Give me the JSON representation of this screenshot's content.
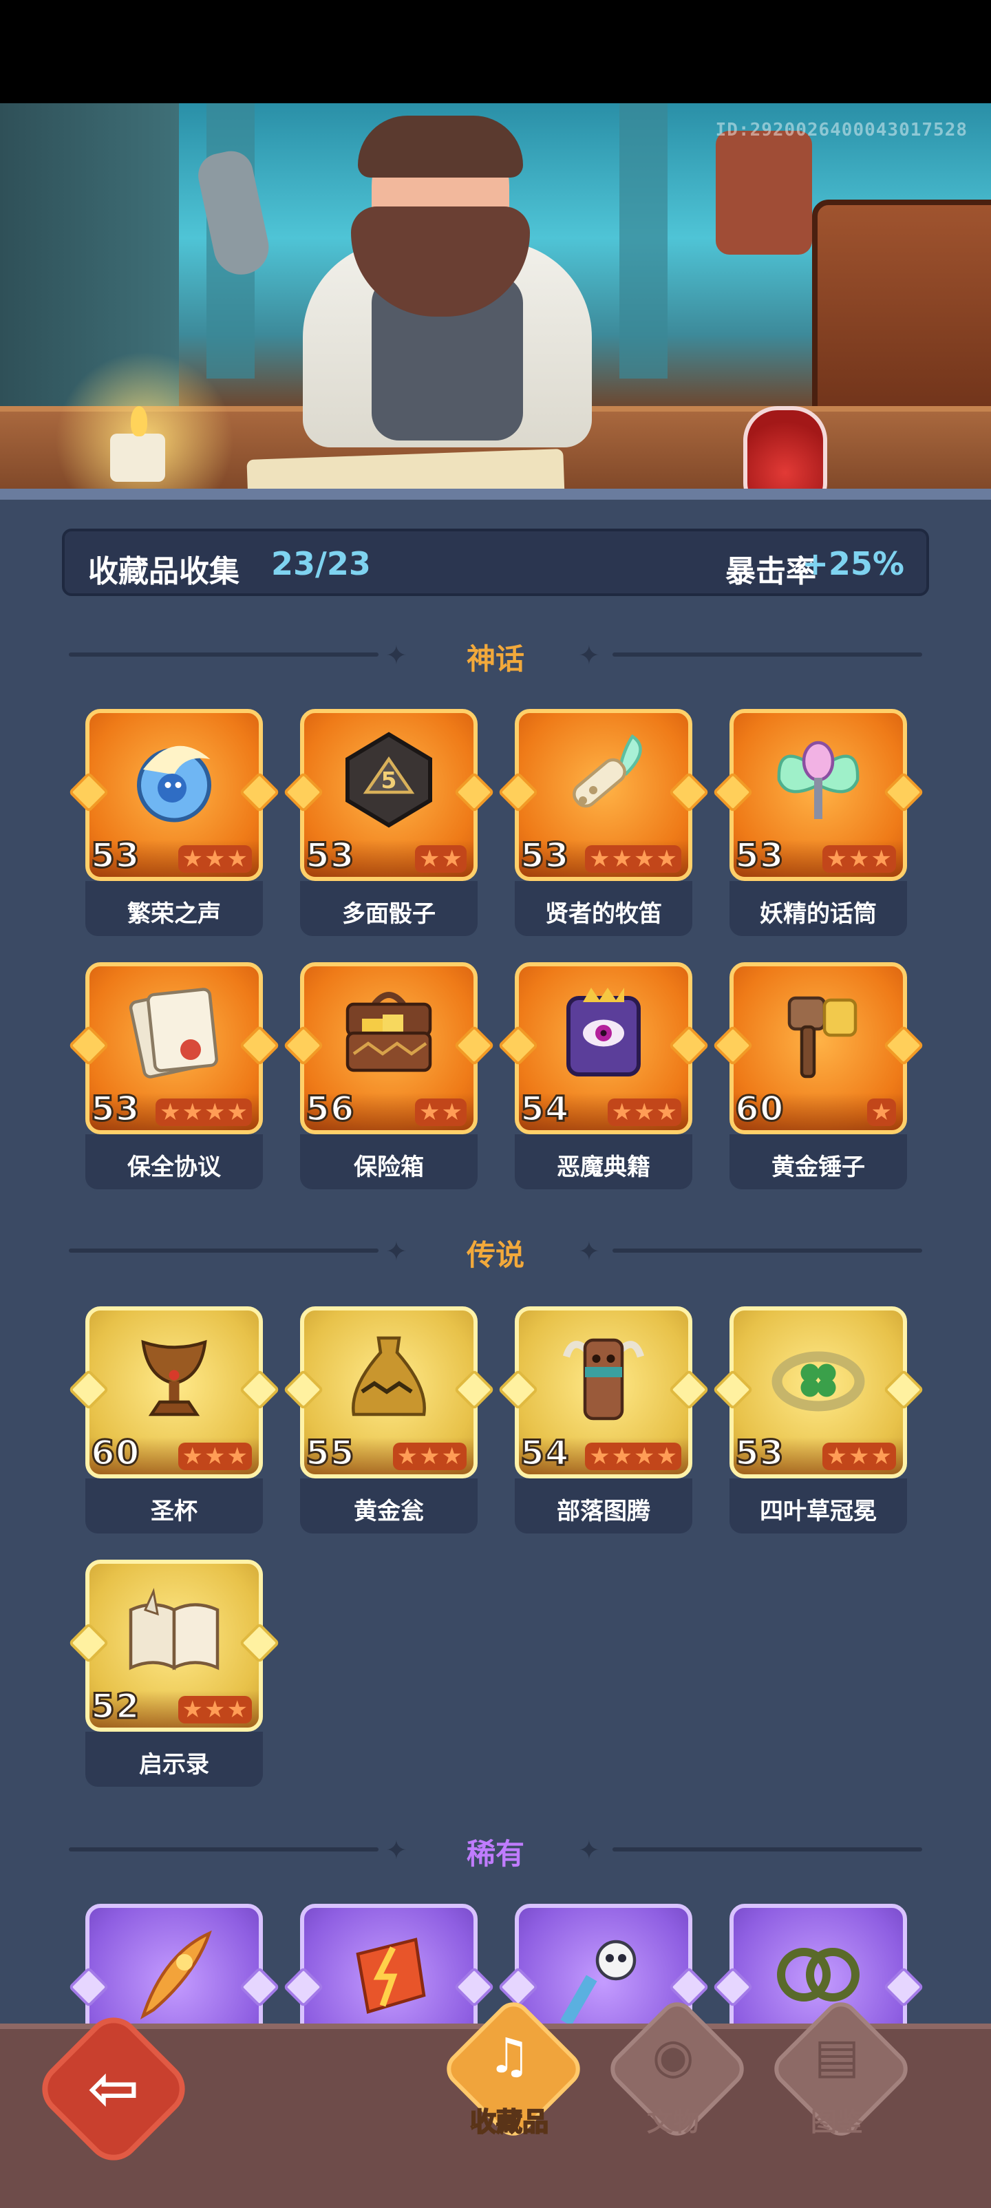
{
  "banner": {
    "id_text": "ID:2920026400043017528"
  },
  "summary": {
    "label": "收藏品收集",
    "count": "23/23",
    "stat_label": "暴击率",
    "stat_value": "+25%"
  },
  "sections": {
    "myth": {
      "title": "神话",
      "color": "#f2a93b"
    },
    "legend": {
      "title": "传说",
      "color": "#f2a93b"
    },
    "rare": {
      "title": "稀有",
      "color": "#c07cff"
    }
  },
  "myth_items": [
    {
      "name": "繁荣之声",
      "level": "53",
      "stars": 3
    },
    {
      "name": "多面骰子",
      "level": "53",
      "stars": 2
    },
    {
      "name": "贤者的牧笛",
      "level": "53",
      "stars": 4
    },
    {
      "name": "妖精的话筒",
      "level": "53",
      "stars": 3
    },
    {
      "name": "保全协议",
      "level": "53",
      "stars": 4
    },
    {
      "name": "保险箱",
      "level": "56",
      "stars": 2
    },
    {
      "name": "恶魔典籍",
      "level": "54",
      "stars": 3
    },
    {
      "name": "黄金锤子",
      "level": "60",
      "stars": 1
    }
  ],
  "legend_items": [
    {
      "name": "圣杯",
      "level": "60",
      "stars": 3
    },
    {
      "name": "黄金瓮",
      "level": "55",
      "stars": 3
    },
    {
      "name": "部落图腾",
      "level": "54",
      "stars": 4
    },
    {
      "name": "四叶草冠冕",
      "level": "53",
      "stars": 3
    },
    {
      "name": "启示录",
      "level": "52",
      "stars": 3
    }
  ],
  "nav": {
    "back_icon": "back-arrow-icon",
    "tabs": [
      {
        "label": "收藏品",
        "icon": "harp-icon",
        "active": true
      },
      {
        "label": "文物",
        "icon": "eye-icon",
        "active": false
      },
      {
        "label": "图鉴",
        "icon": "book-icon",
        "active": false
      }
    ]
  }
}
